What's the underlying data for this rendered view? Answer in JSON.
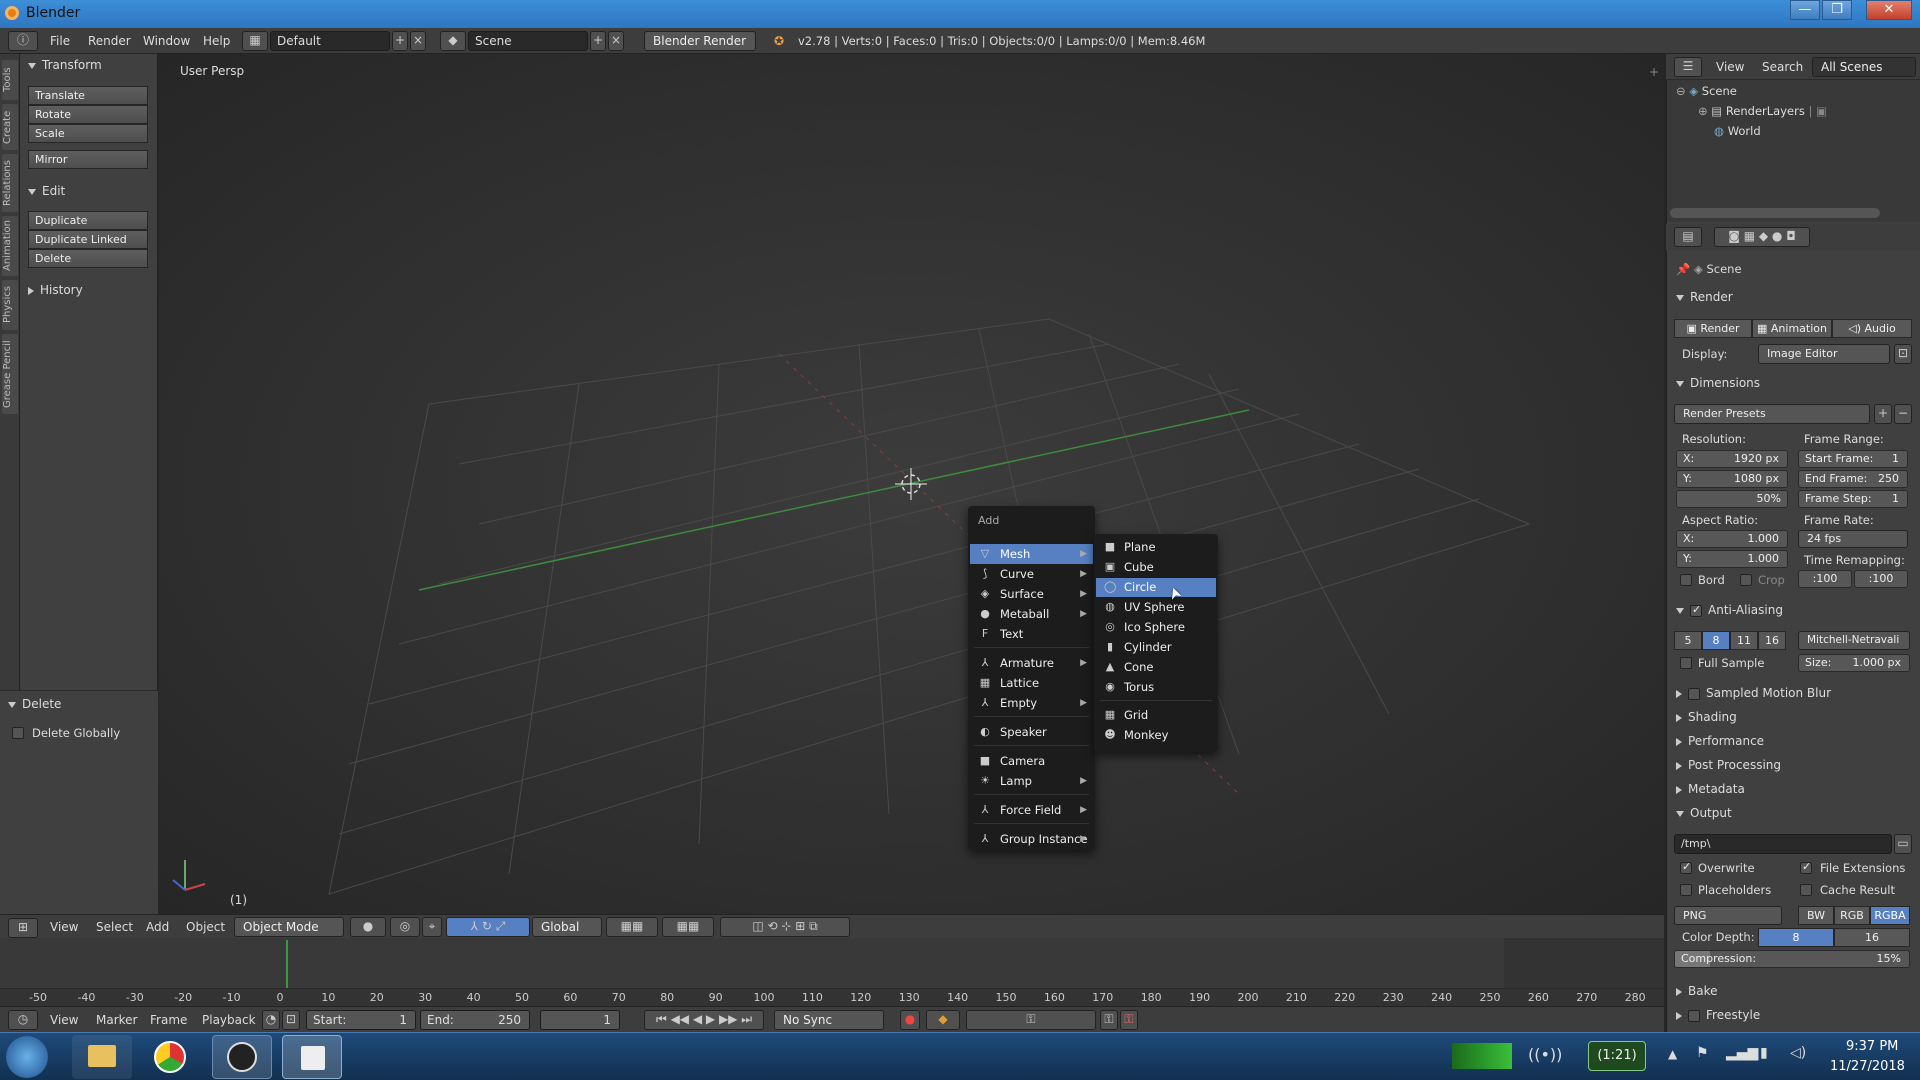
{
  "window": {
    "title": "Blender",
    "minimize": "—",
    "maximize": "❐",
    "close": "✕"
  },
  "infobar": {
    "menus": [
      "File",
      "Render",
      "Window",
      "Help"
    ],
    "layout": "Default",
    "scene": "Scene",
    "engine": "Blender Render",
    "stats": "v2.78 | Verts:0 | Faces:0 | Tris:0 | Objects:0/0 | Lamps:0/0 | Mem:8.46M"
  },
  "lefttabs": [
    "Tools",
    "Create",
    "Relations",
    "Animation",
    "Physics",
    "Grease Pencil"
  ],
  "toolshelf": {
    "transform_title": "Transform",
    "transform": [
      "Translate",
      "Rotate",
      "Scale"
    ],
    "mirror": "Mirror",
    "edit_title": "Edit",
    "edit": [
      "Duplicate",
      "Duplicate Linked",
      "Delete"
    ],
    "history_title": "History",
    "delete_title": "Delete",
    "delete_globally": "Delete Globally"
  },
  "viewport": {
    "label": "User Persp",
    "frame": "(1)"
  },
  "addmenu": {
    "title": "Add",
    "items": [
      {
        "label": "Mesh",
        "icon": "▽",
        "sub": true
      },
      {
        "label": "Curve",
        "icon": "⟆",
        "sub": true
      },
      {
        "label": "Surface",
        "icon": "◈",
        "sub": true
      },
      {
        "label": "Metaball",
        "icon": "●",
        "sub": true
      },
      {
        "label": "Text",
        "icon": "F",
        "sub": false
      },
      {
        "label": "Armature",
        "icon": "⅄",
        "sub": true
      },
      {
        "label": "Lattice",
        "icon": "▦",
        "sub": false
      },
      {
        "label": "Empty",
        "icon": "⅄",
        "sub": true
      },
      {
        "label": "Speaker",
        "icon": "◐",
        "sub": false
      },
      {
        "label": "Camera",
        "icon": "■",
        "sub": false
      },
      {
        "label": "Lamp",
        "icon": "☀",
        "sub": true
      },
      {
        "label": "Force Field",
        "icon": "⅄",
        "sub": true
      },
      {
        "label": "Group Instance",
        "icon": "⅄",
        "sub": true
      }
    ]
  },
  "meshmenu": {
    "items": [
      "Plane",
      "Cube",
      "Circle",
      "UV Sphere",
      "Ico Sphere",
      "Cylinder",
      "Cone",
      "Torus",
      "Grid",
      "Monkey"
    ],
    "icons": [
      "■",
      "▣",
      "◯",
      "◍",
      "◎",
      "▮",
      "▲",
      "◉",
      "▦",
      "☻"
    ],
    "highlighted": "Circle"
  },
  "v3dheader": {
    "menus": [
      "View",
      "Select",
      "Add",
      "Object"
    ],
    "mode": "Object Mode",
    "orientation": "Global"
  },
  "timeline": {
    "ticks": [
      "-50",
      "-40",
      "-30",
      "-20",
      "-10",
      "0",
      "10",
      "20",
      "30",
      "40",
      "50",
      "60",
      "70",
      "80",
      "90",
      "100",
      "110",
      "120",
      "130",
      "140",
      "150",
      "160",
      "170",
      "180",
      "190",
      "200",
      "210",
      "220",
      "230",
      "240",
      "250",
      "260",
      "270",
      "280"
    ],
    "menus": [
      "View",
      "Marker",
      "Frame",
      "Playback"
    ],
    "start": "Start:",
    "start_val": "1",
    "end": "End:",
    "end_val": "250",
    "current": "1",
    "sync": "No Sync"
  },
  "outliner": {
    "menus": [
      "View",
      "Search"
    ],
    "filter": "All Scenes",
    "tree": [
      "Scene",
      "RenderLayers",
      "World"
    ]
  },
  "properties": {
    "breadcrumb": "Scene",
    "render_title": "Render",
    "render_buttons": [
      "Render",
      "Animation",
      "Audio"
    ],
    "display_label": "Display:",
    "display_value": "Image Editor",
    "dimensions_title": "Dimensions",
    "render_presets": "Render Presets",
    "resolution_label": "Resolution:",
    "res_x": "X:",
    "res_x_val": "1920 px",
    "res_y": "Y:",
    "res_y_val": "1080 px",
    "res_pct": "50%",
    "frame_range_label": "Frame Range:",
    "start_frame": "Start Frame:",
    "start_frame_val": "1",
    "end_frame": "End Frame:",
    "end_frame_val": "250",
    "frame_step": "Frame Step:",
    "frame_step_val": "1",
    "aspect_label": "Aspect Ratio:",
    "asp_x": "X:",
    "asp_x_val": "1.000",
    "asp_y": "Y:",
    "asp_y_val": "1.000",
    "frame_rate_label": "Frame Rate:",
    "fps": "24 fps",
    "time_remap_label": "Time Remapping:",
    "remap_old": ":100",
    "remap_new": ":100",
    "bord": "Bord",
    "crop": "Crop",
    "aa_title": "Anti-Aliasing",
    "aa_samples": [
      "5",
      "8",
      "11",
      "16"
    ],
    "aa_filter": "Mitchell-Netravali",
    "full_sample": "Full Sample",
    "size": "Size:",
    "size_val": "1.000 px",
    "collapsed": [
      "Sampled Motion Blur",
      "Shading",
      "Performance",
      "Post Processing",
      "Metadata"
    ],
    "output_title": "Output",
    "output_path": "/tmp\\",
    "overwrite": "Overwrite",
    "file_ext": "File Extensions",
    "placeholders": "Placeholders",
    "cache_result": "Cache Result",
    "format": "PNG",
    "color_modes": [
      "BW",
      "RGB",
      "RGBA"
    ],
    "color_depth_label": "Color Depth:",
    "depths": [
      "8",
      "16"
    ],
    "compression": "Compression:",
    "compression_val": "15%",
    "bake": "Bake",
    "freestyle": "Freestyle"
  },
  "taskbar": {
    "battery": "(1:21)",
    "time": "9:37 PM",
    "date": "11/27/2018"
  }
}
